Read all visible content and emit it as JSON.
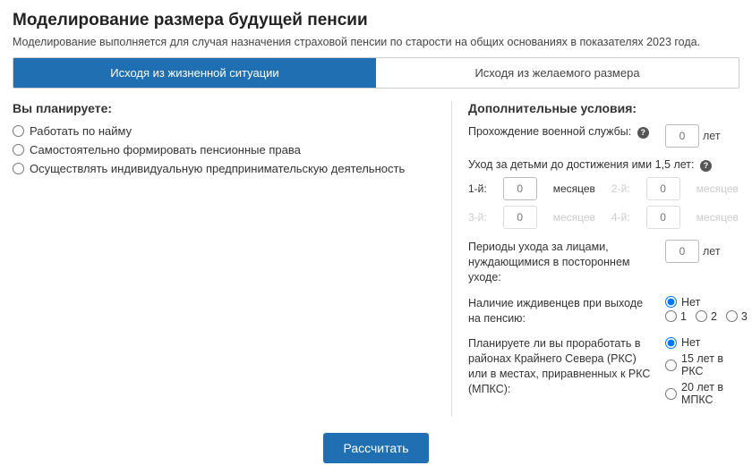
{
  "title": "Моделирование размера будущей пенсии",
  "subtitle": "Моделирование выполняется для случая назначения страховой пенсии по старости на общих основаниях в показателях 2023 года.",
  "tabs": {
    "situation": "Исходя из жизненной ситуации",
    "desired": "Исходя из желаемого размера"
  },
  "left": {
    "heading": "Вы планируете:",
    "options": [
      "Работать по найму",
      "Самостоятельно формировать пенсионные права",
      "Осуществлять индивидуальную предпринимательскую деятельность"
    ]
  },
  "right": {
    "heading": "Дополнительные условия:",
    "military": {
      "label": "Прохождение военной службы:",
      "unit": "лет",
      "placeholder": "0"
    },
    "children": {
      "label": "Уход за детьми до достижения ими 1,5 лет:",
      "ordinals": [
        "1-й:",
        "2-й:",
        "3-й:",
        "4-й:"
      ],
      "unit": "месяцев",
      "placeholder": "0"
    },
    "care": {
      "label": "Периоды ухода за лицами, нуждающимися в постороннем уходе:",
      "unit": "лет",
      "placeholder": "0"
    },
    "dependents": {
      "label": "Наличие иждивенцев при выходе на пенсию:",
      "options": [
        "Нет",
        "1",
        "2",
        "3"
      ],
      "selected": "Нет"
    },
    "north": {
      "label": "Планируете ли вы проработать в районах Крайнего Севера (РКС) или в местах, приравненных к РКС (МПКС):",
      "options": [
        "Нет",
        "15 лет в РКС",
        "20 лет в МПКС"
      ],
      "selected": "Нет"
    }
  },
  "calculate": "Рассчитать"
}
